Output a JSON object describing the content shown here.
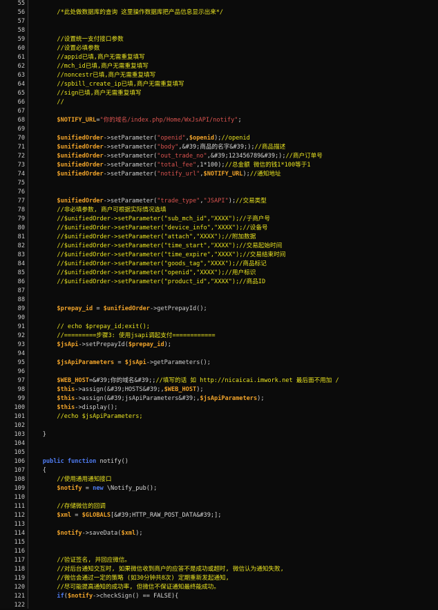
{
  "editor": {
    "lines": [
      {
        "n": "55",
        "t": []
      },
      {
        "n": "56",
        "t": [
          [
            "cm",
            "        /*此处做数据库的查询 这里操作数据库把产品信息显示出来*/"
          ]
        ]
      },
      {
        "n": "57",
        "t": []
      },
      {
        "n": "58",
        "t": []
      },
      {
        "n": "59",
        "t": [
          [
            "cm",
            "        //设置统一支付接口参数"
          ]
        ]
      },
      {
        "n": "60",
        "t": [
          [
            "cm",
            "        //设置必填参数"
          ]
        ]
      },
      {
        "n": "61",
        "t": [
          [
            "cm",
            "        //appid已填,商户无需重复填写"
          ]
        ]
      },
      {
        "n": "62",
        "t": [
          [
            "cm",
            "        //mch_id已填,商户无需重复填写"
          ]
        ]
      },
      {
        "n": "63",
        "t": [
          [
            "cm",
            "        //noncestr已填,商户无需重复填写"
          ]
        ]
      },
      {
        "n": "64",
        "t": [
          [
            "cm",
            "        //spbill_create_ip已填,商户无需重复填写"
          ]
        ]
      },
      {
        "n": "65",
        "t": [
          [
            "cm",
            "        //sign已填,商户无需重复填写"
          ]
        ]
      },
      {
        "n": "66",
        "t": [
          [
            "cm",
            "        //"
          ]
        ]
      },
      {
        "n": "67",
        "t": []
      },
      {
        "n": "68",
        "t": [
          [
            "vr",
            "        $NOTIFY_URL"
          ],
          [
            "pl",
            "="
          ],
          [
            "st",
            "\"你的域名/index.php/Home/WxJsAPI/notify\""
          ],
          [
            "pl",
            ";"
          ]
        ]
      },
      {
        "n": "69",
        "t": []
      },
      {
        "n": "70",
        "t": [
          [
            "vr",
            "        $unifiedOrder"
          ],
          [
            "fn",
            "->setParameter("
          ],
          [
            "st",
            "\"openid\""
          ],
          [
            "pl",
            ","
          ],
          [
            "vr",
            "$openid"
          ],
          [
            "pl",
            ");"
          ],
          [
            "cm",
            "//openid"
          ]
        ]
      },
      {
        "n": "71",
        "t": [
          [
            "vr",
            "        $unifiedOrder"
          ],
          [
            "fn",
            "->setParameter("
          ],
          [
            "st",
            "\"body\""
          ],
          [
            "pl",
            ",&#39;商品的名字&#39;);"
          ],
          [
            "cm",
            "//商品描述"
          ]
        ]
      },
      {
        "n": "72",
        "t": [
          [
            "vr",
            "        $unifiedOrder"
          ],
          [
            "fn",
            "->setParameter("
          ],
          [
            "st",
            "\"out_trade_no\""
          ],
          [
            "pl",
            ",&#39;123456789&#39;);"
          ],
          [
            "cm",
            "//商户订单号"
          ]
        ]
      },
      {
        "n": "73",
        "t": [
          [
            "vr",
            "        $unifiedOrder"
          ],
          [
            "fn",
            "->setParameter("
          ],
          [
            "st",
            "\"total_fee\""
          ],
          [
            "pl",
            ",1*100);"
          ],
          [
            "cm",
            "//总金额 微信的钱1*100等于1"
          ]
        ]
      },
      {
        "n": "74",
        "t": [
          [
            "vr",
            "        $unifiedOrder"
          ],
          [
            "fn",
            "->setParameter("
          ],
          [
            "st",
            "\"notify_url\""
          ],
          [
            "pl",
            ","
          ],
          [
            "vr",
            "$NOTIFY_URL"
          ],
          [
            "pl",
            ");"
          ],
          [
            "cm",
            "//通知地址"
          ]
        ]
      },
      {
        "n": "75",
        "t": []
      },
      {
        "n": "76",
        "t": []
      },
      {
        "n": "77",
        "t": [
          [
            "vr",
            "        $unifiedOrder"
          ],
          [
            "fn",
            "->setParameter("
          ],
          [
            "st",
            "\"trade_type\""
          ],
          [
            "pl",
            ","
          ],
          [
            "st",
            "\"JSAPI\""
          ],
          [
            "pl",
            ");"
          ],
          [
            "cm",
            "//交易类型"
          ]
        ]
      },
      {
        "n": "78",
        "t": [
          [
            "cm",
            "        //非必填参数, 商户可根据实际情况选填"
          ]
        ]
      },
      {
        "n": "79",
        "t": [
          [
            "cm",
            "        //$unifiedOrder->setParameter(\"sub_mch_id\",\"XXXX\");//子商户号"
          ]
        ]
      },
      {
        "n": "80",
        "t": [
          [
            "cm",
            "        //$unifiedOrder->setParameter(\"device_info\",\"XXXX\");//设备号"
          ]
        ]
      },
      {
        "n": "81",
        "t": [
          [
            "cm",
            "        //$unifiedOrder->setParameter(\"attach\",\"XXXX\");//附加数据"
          ]
        ]
      },
      {
        "n": "82",
        "t": [
          [
            "cm",
            "        //$unifiedOrder->setParameter(\"time_start\",\"XXXX\");//交易起始时间"
          ]
        ]
      },
      {
        "n": "83",
        "t": [
          [
            "cm",
            "        //$unifiedOrder->setParameter(\"time_expire\",\"XXXX\");//交易结束时间"
          ]
        ]
      },
      {
        "n": "84",
        "t": [
          [
            "cm",
            "        //$unifiedOrder->setParameter(\"goods_tag\",\"XXXX\");//商品标记"
          ]
        ]
      },
      {
        "n": "85",
        "t": [
          [
            "cm",
            "        //$unifiedOrder->setParameter(\"openid\",\"XXXX\");//用户标识"
          ]
        ]
      },
      {
        "n": "86",
        "t": [
          [
            "cm",
            "        //$unifiedOrder->setParameter(\"product_id\",\"XXXX\");//商品ID"
          ]
        ]
      },
      {
        "n": "87",
        "t": []
      },
      {
        "n": "88",
        "t": []
      },
      {
        "n": "89",
        "t": [
          [
            "vr",
            "        $prepay_id"
          ],
          [
            "pl",
            " = "
          ],
          [
            "vr",
            "$unifiedOrder"
          ],
          [
            "fn",
            "->getPrepayId();"
          ]
        ]
      },
      {
        "n": "90",
        "t": []
      },
      {
        "n": "91",
        "t": [
          [
            "cm",
            "        // echo $prepay_id;exit();"
          ]
        ]
      },
      {
        "n": "92",
        "t": [
          [
            "cm",
            "        //=========步骤3: 使用jsapi调起支付============"
          ]
        ]
      },
      {
        "n": "93",
        "t": [
          [
            "vr",
            "        $jsApi"
          ],
          [
            "fn",
            "->setPrepayId("
          ],
          [
            "vr",
            "$prepay_id"
          ],
          [
            "pl",
            ");"
          ]
        ]
      },
      {
        "n": "94",
        "t": []
      },
      {
        "n": "95",
        "t": [
          [
            "vr",
            "        $jsApiParameters"
          ],
          [
            "pl",
            " = "
          ],
          [
            "vr",
            "$jsApi"
          ],
          [
            "fn",
            "->getParameters();"
          ]
        ]
      },
      {
        "n": "96",
        "t": []
      },
      {
        "n": "97",
        "t": [
          [
            "vr",
            "        $WEB_HOST"
          ],
          [
            "pl",
            "=&#39;你的域名&#39;;"
          ],
          [
            "cm",
            "//填写的话 如 http://nicaicai.imwork.net 最后面不用加 /"
          ]
        ]
      },
      {
        "n": "98",
        "t": [
          [
            "vr",
            "        $this"
          ],
          [
            "fn",
            "->assign(&#39;HOSTS&#39;,"
          ],
          [
            "vr",
            "$WEB_HOST"
          ],
          [
            "pl",
            ");"
          ]
        ]
      },
      {
        "n": "99",
        "t": [
          [
            "vr",
            "        $this"
          ],
          [
            "fn",
            "->assign(&#39;jsApiParameters&#39;,"
          ],
          [
            "vr",
            "$jsApiParameters"
          ],
          [
            "pl",
            ");"
          ]
        ]
      },
      {
        "n": "100",
        "t": [
          [
            "vr",
            "        $this"
          ],
          [
            "fn",
            "->display();"
          ]
        ]
      },
      {
        "n": "101",
        "t": [
          [
            "cm",
            "        //echo $jsApiParameters;"
          ]
        ]
      },
      {
        "n": "102",
        "t": []
      },
      {
        "n": "103",
        "t": [
          [
            "pl",
            "    }"
          ]
        ]
      },
      {
        "n": "104",
        "t": []
      },
      {
        "n": "105",
        "t": []
      },
      {
        "n": "106",
        "t": [
          [
            "kw",
            "    public function"
          ],
          [
            "pl",
            " notify()"
          ]
        ]
      },
      {
        "n": "107",
        "t": [
          [
            "pl",
            "    {"
          ]
        ]
      },
      {
        "n": "108",
        "t": [
          [
            "cm",
            "        //使用通用通知接口"
          ]
        ]
      },
      {
        "n": "109",
        "t": [
          [
            "vr",
            "        $notify"
          ],
          [
            "pl",
            " = "
          ],
          [
            "kw",
            "new"
          ],
          [
            "pl",
            " \\Notify_pub();"
          ]
        ]
      },
      {
        "n": "110",
        "t": []
      },
      {
        "n": "111",
        "t": [
          [
            "cm",
            "        //存储微信的回调"
          ]
        ]
      },
      {
        "n": "112",
        "t": [
          [
            "vr",
            "        $xml"
          ],
          [
            "pl",
            " = "
          ],
          [
            "vr",
            "$GLOBALS"
          ],
          [
            "pl",
            "[&#39;HTTP_RAW_POST_DATA&#39;];"
          ]
        ]
      },
      {
        "n": "113",
        "t": []
      },
      {
        "n": "114",
        "t": [
          [
            "vr",
            "        $notify"
          ],
          [
            "fn",
            "->saveData("
          ],
          [
            "vr",
            "$xml"
          ],
          [
            "pl",
            ");"
          ]
        ]
      },
      {
        "n": "115",
        "t": []
      },
      {
        "n": "116",
        "t": []
      },
      {
        "n": "117",
        "t": [
          [
            "cm",
            "        //验证签名, 并回应微信。"
          ]
        ]
      },
      {
        "n": "118",
        "t": [
          [
            "cm",
            "        //对后台通知交互时, 如果微信收到商户的应答不是成功或超时, 微信认为通知失败,"
          ]
        ]
      },
      {
        "n": "119",
        "t": [
          [
            "cm",
            "        //微信会通过一定的策略 (如30分钟共8次) 定期重新发起通知,"
          ]
        ]
      },
      {
        "n": "120",
        "t": [
          [
            "cm",
            "        //尽可能提高通知的成功率, 但微信不保证通知最终能成功。"
          ]
        ]
      },
      {
        "n": "121",
        "t": [
          [
            "kw",
            "        if"
          ],
          [
            "pl",
            "("
          ],
          [
            "vr",
            "$notify"
          ],
          [
            "fn",
            "->checkSign()"
          ],
          [
            "pl",
            " == FALSE){"
          ]
        ]
      },
      {
        "n": "122",
        "t": []
      }
    ]
  }
}
